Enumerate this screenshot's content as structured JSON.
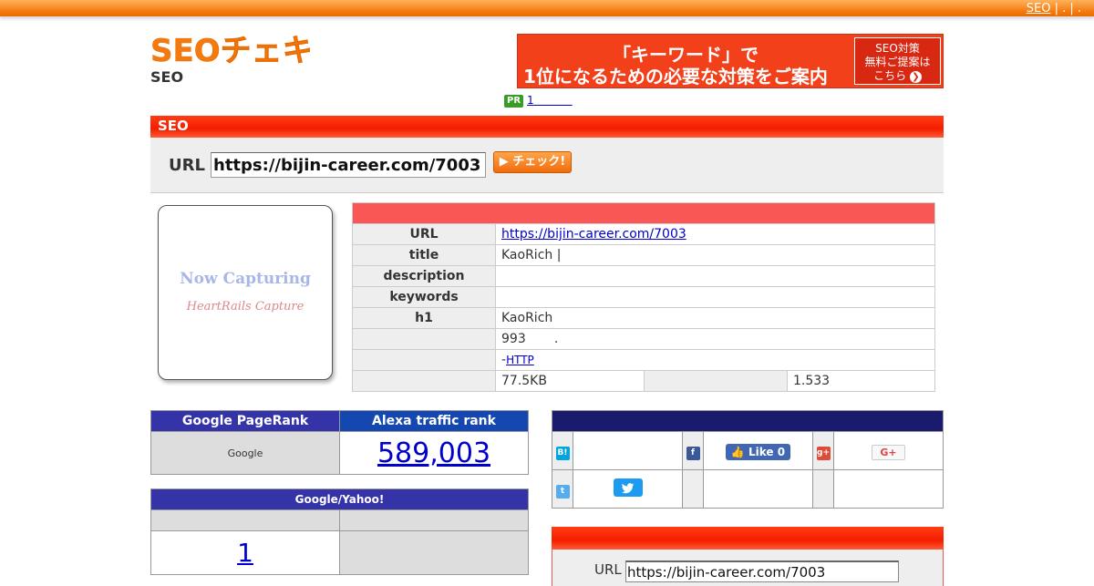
{
  "topbar": {
    "link": "SEO",
    "separators": " | . | ."
  },
  "header": {
    "logo_text": "SEOチェキ!",
    "subtitle": "SEO",
    "banner": {
      "line1": "「キーワード」で",
      "line2": "1位になるための必要な対策をご案内",
      "button_line1": "SEO対策",
      "button_line2": "無料ご提案は",
      "button_line3": "こちら"
    },
    "pr_badge": "PR",
    "pr_link": "1"
  },
  "search": {
    "section_title": "SEO",
    "url_label": "URL",
    "url_value": "https://bijin-career.com/7003",
    "check_button": "▶ チェック!"
  },
  "capture": {
    "line1": "Now Capturing",
    "line2": "HeartRails Capture"
  },
  "info": {
    "rows": [
      {
        "key": "URL",
        "value": "https://bijin-career.com/7003"
      },
      {
        "key": "title",
        "value": "KaoRich |"
      },
      {
        "key": "description",
        "value": ""
      },
      {
        "key": "keywords",
        "value": ""
      },
      {
        "key": "h1",
        "value": "KaoRich"
      }
    ],
    "word_count": "993",
    "word_count_suffix": ".",
    "http_prefix": "-",
    "http_link": "HTTP",
    "size": "77.5KB",
    "time": "1.533"
  },
  "rank": {
    "pagerank_header": "Google PageRank",
    "alexa_header": "Alexa traffic rank",
    "pagerank_value": "Google",
    "alexa_value": "589,003"
  },
  "google_yahoo": {
    "header": "Google/Yahoo!",
    "value": "1"
  },
  "social": {
    "hatena_icon": "B!",
    "facebook_icon": "f",
    "gplus_icon": "g+",
    "twitter_icon": "t",
    "fb_like_label": "Like 0",
    "gplus_button": "G+"
  },
  "bottom": {
    "url_label": "URL",
    "url_value": "https://bijin-career.com/7003"
  },
  "colors": {
    "brand_orange": "#f47a10",
    "section_red": "#f41e00",
    "header_blue": "#3434a8"
  }
}
